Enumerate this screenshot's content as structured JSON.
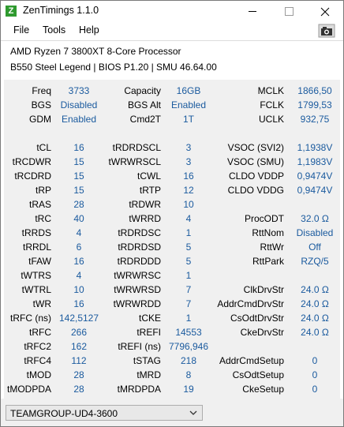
{
  "window": {
    "title": "ZenTimings 1.1.0"
  },
  "menu": {
    "file": "File",
    "tools": "Tools",
    "help": "Help"
  },
  "system": {
    "cpu": "AMD Ryzen 7 3800XT 8-Core Processor",
    "board": "B550 Steel Legend | BIOS P1.20 | SMU 46.64.00"
  },
  "top_rows": [
    [
      [
        "Freq",
        "3733"
      ],
      [
        "Capacity",
        "16GB"
      ],
      [
        "MCLK",
        "1866,50"
      ]
    ],
    [
      [
        "BGS",
        "Disabled"
      ],
      [
        "BGS Alt",
        "Enabled"
      ],
      [
        "FCLK",
        "1799,53"
      ]
    ],
    [
      [
        "GDM",
        "Enabled"
      ],
      [
        "Cmd2T",
        "1T"
      ],
      [
        "UCLK",
        "932,75"
      ]
    ]
  ],
  "timing_rows": [
    [
      [
        "tCL",
        "16"
      ],
      [
        "tRDRDSCL",
        "3"
      ],
      [
        "VSOC (SVI2)",
        "1,1938V"
      ]
    ],
    [
      [
        "tRCDWR",
        "15"
      ],
      [
        "tWRWRSCL",
        "3"
      ],
      [
        "VSOC (SMU)",
        "1,1983V"
      ]
    ],
    [
      [
        "tRCDRD",
        "15"
      ],
      [
        "tCWL",
        "16"
      ],
      [
        "CLDO VDDP",
        "0,9474V"
      ]
    ],
    [
      [
        "tRP",
        "15"
      ],
      [
        "tRTP",
        "12"
      ],
      [
        "CLDO VDDG",
        "0,9474V"
      ]
    ],
    [
      [
        "tRAS",
        "28"
      ],
      [
        "tRDWR",
        "10"
      ],
      [
        "",
        ""
      ]
    ],
    [
      [
        "tRC",
        "40"
      ],
      [
        "tWRRD",
        "4"
      ],
      [
        "ProcODT",
        "32.0 Ω"
      ]
    ],
    [
      [
        "tRRDS",
        "4"
      ],
      [
        "tRDRDSC",
        "1"
      ],
      [
        "RttNom",
        "Disabled"
      ]
    ],
    [
      [
        "tRRDL",
        "6"
      ],
      [
        "tRDRDSD",
        "5"
      ],
      [
        "RttWr",
        "Off"
      ]
    ],
    [
      [
        "tFAW",
        "16"
      ],
      [
        "tRDRDDD",
        "5"
      ],
      [
        "RttPark",
        "RZQ/5"
      ]
    ],
    [
      [
        "tWTRS",
        "4"
      ],
      [
        "tWRWRSC",
        "1"
      ],
      [
        "",
        ""
      ]
    ],
    [
      [
        "tWTRL",
        "10"
      ],
      [
        "tWRWRSD",
        "7"
      ],
      [
        "ClkDrvStr",
        "24.0 Ω"
      ]
    ],
    [
      [
        "tWR",
        "16"
      ],
      [
        "tWRWRDD",
        "7"
      ],
      [
        "AddrCmdDrvStr",
        "24.0 Ω"
      ]
    ],
    [
      [
        "tRFC (ns)",
        "142,5127"
      ],
      [
        "tCKE",
        "1"
      ],
      [
        "CsOdtDrvStr",
        "24.0 Ω"
      ]
    ],
    [
      [
        "tRFC",
        "266"
      ],
      [
        "tREFI",
        "14553"
      ],
      [
        "CkeDrvStr",
        "24.0 Ω"
      ]
    ],
    [
      [
        "tRFC2",
        "162"
      ],
      [
        "tREFI (ns)",
        "7796,946"
      ],
      [
        "",
        ""
      ]
    ],
    [
      [
        "tRFC4",
        "112"
      ],
      [
        "tSTAG",
        "218"
      ],
      [
        "AddrCmdSetup",
        "0"
      ]
    ],
    [
      [
        "tMOD",
        "28"
      ],
      [
        "tMRD",
        "8"
      ],
      [
        "CsOdtSetup",
        "0"
      ]
    ],
    [
      [
        "tMODPDA",
        "28"
      ],
      [
        "tMRDPDA",
        "19"
      ],
      [
        "CkeSetup",
        "0"
      ]
    ]
  ],
  "profile": {
    "selected": "TEAMGROUP-UD4-3600"
  },
  "icons": {
    "app": "zentimings-app-icon",
    "screenshot": "camera-icon",
    "dropdown": "chevron-down-icon"
  },
  "colors": {
    "value_text": "#1a5a9e",
    "panel_bg": "#f0f0f0",
    "app_icon": "#2f9a2f"
  }
}
